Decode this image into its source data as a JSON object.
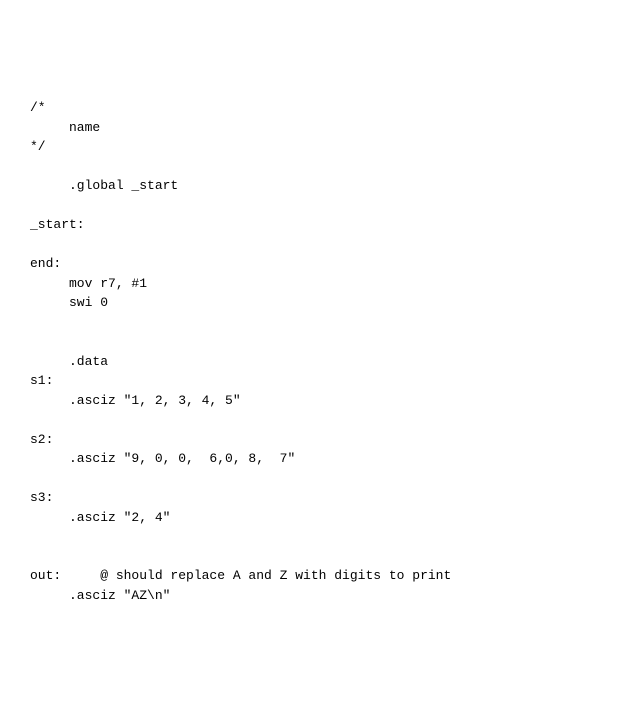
{
  "code": {
    "lines": [
      "/*",
      "     name",
      "*/",
      "",
      "     .global _start",
      "",
      "_start:",
      "",
      "end:",
      "     mov r7, #1",
      "     swi 0",
      "",
      "",
      "     .data",
      "s1:",
      "     .asciz \"1, 2, 3, 4, 5\"",
      "",
      "s2:",
      "     .asciz \"9, 0, 0,  6,0, 8,  7\"",
      "",
      "s3:",
      "     .asciz \"2, 4\"",
      "",
      "",
      "out:     @ should replace A and Z with digits to print",
      "     .asciz \"AZ\\n\""
    ]
  }
}
